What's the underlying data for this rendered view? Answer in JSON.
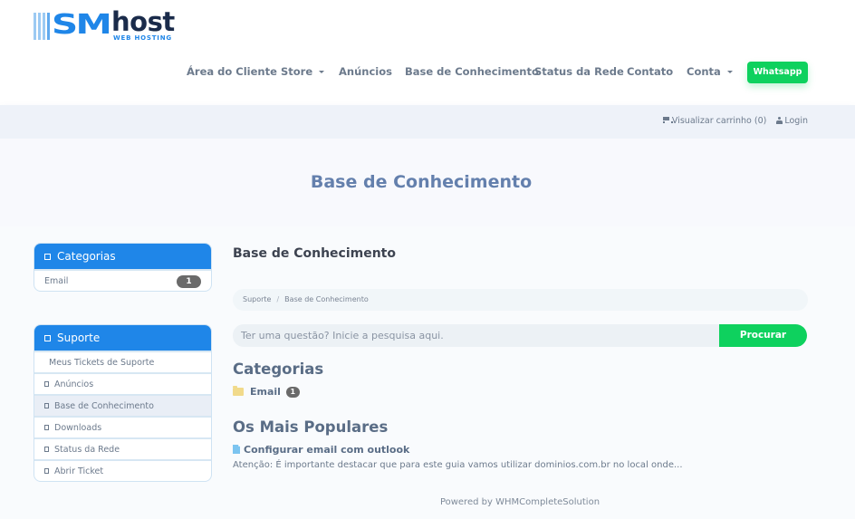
{
  "logo": {
    "mark": "SM",
    "name": "host",
    "tagline": "WEB HOSTING"
  },
  "nav": {
    "items": [
      {
        "label": "Área do Cliente",
        "dropdown": false
      },
      {
        "label": "Store",
        "dropdown": true
      },
      {
        "label": "Anúncios",
        "dropdown": false
      },
      {
        "label": "Base de Conhecimento",
        "dropdown": false
      },
      {
        "label": "Status da Rede",
        "dropdown": false
      },
      {
        "label": "Contato",
        "dropdown": false
      },
      {
        "label": "Conta",
        "dropdown": true
      }
    ],
    "whatsapp_label": "Whatsapp"
  },
  "topbar": {
    "cart_label": "Visualizar carrinho (0)",
    "login_label": "Login"
  },
  "page_title": "Base de Conhecimento",
  "sidebar": {
    "categories": {
      "title": "Categorias",
      "items": [
        {
          "label": "Email",
          "count": "1"
        }
      ]
    },
    "support": {
      "title": "Suporte",
      "items": [
        {
          "label": "Meus Tickets de Suporte",
          "icon": false,
          "active": false
        },
        {
          "label": "Anúncios",
          "icon": true,
          "active": false
        },
        {
          "label": "Base de Conhecimento",
          "icon": true,
          "active": true
        },
        {
          "label": "Downloads",
          "icon": true,
          "active": false
        },
        {
          "label": "Status da Rede",
          "icon": true,
          "active": false
        },
        {
          "label": "Abrir Ticket",
          "icon": true,
          "active": false
        }
      ]
    }
  },
  "main": {
    "title": "Base de Conhecimento",
    "breadcrumb": [
      "Suporte",
      "Base de Conhecimento"
    ],
    "breadcrumb_separator": "/",
    "search": {
      "placeholder": "Ter uma questão? Inicie a pesquisa aqui.",
      "value": "",
      "button_label": "Procurar"
    },
    "categories_heading": "Categorias",
    "categories": [
      {
        "label": "Email",
        "count": "1",
        "icon": "folder-icon"
      }
    ],
    "popular_heading": "Os Mais Populares",
    "popular": [
      {
        "title": "Configurar email com outlook",
        "excerpt": "Atenção: É importante destacar que para este guia vamos utilizar dominios.com.br no local onde...",
        "icon": "document-icon"
      }
    ]
  },
  "footer": {
    "text": "Powered by WHMCompleteSolution"
  },
  "colors": {
    "brand_blue": "#1f86e8",
    "accent_green": "#0ed15e",
    "heading": "#6480ad",
    "badge": "#6a6a6a"
  }
}
